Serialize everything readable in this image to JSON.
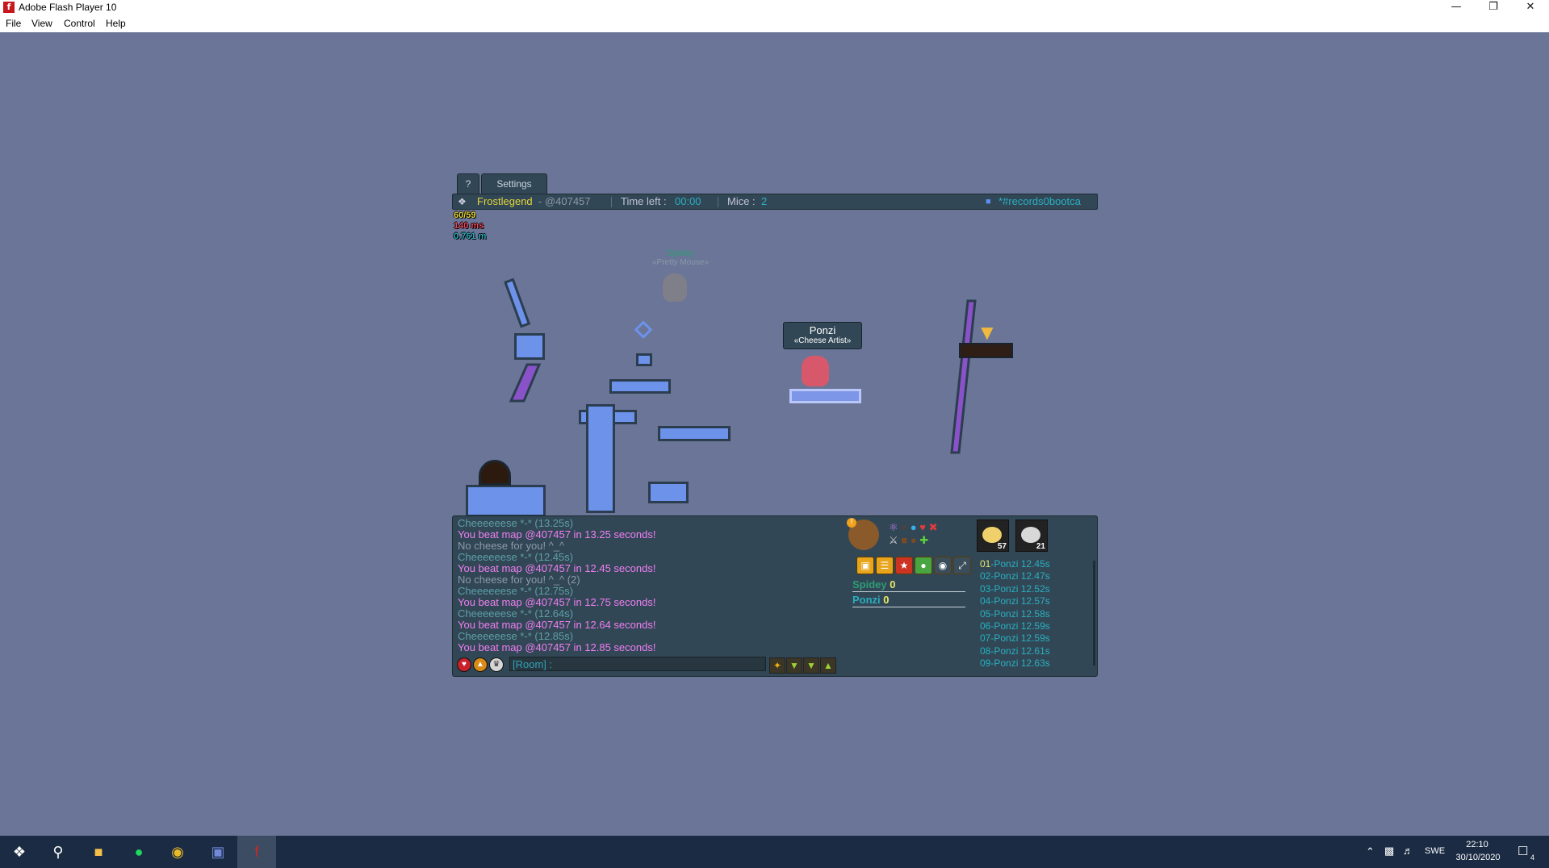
{
  "window": {
    "title": "Adobe Flash Player 10",
    "icon": "flash-icon",
    "controls": [
      "minimize",
      "restore",
      "close"
    ]
  },
  "menu": {
    "items": [
      "File",
      "View",
      "Control",
      "Help"
    ]
  },
  "game": {
    "tabs": {
      "help": "?",
      "settings": "Settings"
    },
    "infobar": {
      "author": "Frostlegend",
      "map_code": " - @407457",
      "time_label": "Time left :",
      "time_value": "00:00",
      "mice_label": "Mice :",
      "mice_value": "2",
      "room": "*#records0bootca"
    },
    "hud": {
      "fps": "60/59",
      "ping": "140 ms",
      "distance": "0.761 m"
    },
    "players": {
      "spidey_name": "Spidey",
      "spidey_title": "«Pretty Mouse»",
      "ponzi_name": "Ponzi",
      "ponzi_title": "«Cheese Artist»"
    },
    "chat": [
      {
        "text": "Cheeeeeese *-* ",
        "extra": "(13.25s)",
        "kind": "green"
      },
      {
        "text": "You beat map @407457 in 13.25 seconds!",
        "kind": "pink"
      },
      {
        "text": "No cheese for you! ^_^",
        "kind": "grey"
      },
      {
        "text": "Cheeeeeese *-* ",
        "extra": "(12.45s)",
        "kind": "green"
      },
      {
        "text": "You beat map @407457 in 12.45 seconds!",
        "kind": "pink"
      },
      {
        "text": "No cheese for you! ^_^ (2)",
        "kind": "grey"
      },
      {
        "text": "Cheeeeeese *-* ",
        "extra": "(12.75s)",
        "kind": "green"
      },
      {
        "text": "You beat map @407457 in 12.75 seconds!",
        "kind": "pink"
      },
      {
        "text": "Cheeeeeese *-* ",
        "extra": "(12.64s)",
        "kind": "green"
      },
      {
        "text": "You beat map @407457 in 12.64 seconds!",
        "kind": "pink"
      },
      {
        "text": "Cheeeeeese *-* ",
        "extra": "(12.85s)",
        "kind": "green"
      },
      {
        "text": "You beat map @407457 in 12.85 seconds!",
        "kind": "pink"
      }
    ],
    "chat_input_prefix": "[Room] :",
    "scores": [
      {
        "name": "Spidey",
        "score": "0"
      },
      {
        "name": "Ponzi",
        "score": "0"
      }
    ],
    "avatars": [
      {
        "count": "57"
      },
      {
        "count": "21"
      }
    ],
    "leaderboard": [
      {
        "rank": "01",
        "name": "-Ponzi ",
        "time": "12.45s"
      },
      {
        "rank": "02",
        "name": "-Ponzi ",
        "time": "12.47s"
      },
      {
        "rank": "03",
        "name": "-Ponzi ",
        "time": "12.52s"
      },
      {
        "rank": "04",
        "name": "-Ponzi ",
        "time": "12.57s"
      },
      {
        "rank": "05",
        "name": "-Ponzi ",
        "time": "12.58s"
      },
      {
        "rank": "06",
        "name": "-Ponzi ",
        "time": "12.59s"
      },
      {
        "rank": "07",
        "name": "-Ponzi ",
        "time": "12.59s"
      },
      {
        "rank": "08",
        "name": "-Ponzi ",
        "time": "12.61s"
      },
      {
        "rank": "09",
        "name": "-Ponzi ",
        "time": "12.63s"
      }
    ]
  },
  "taskbar": {
    "language": "SWE",
    "time": "22:10",
    "date": "30/10/2020",
    "notifications": "4"
  },
  "colors": {
    "background": "#6a7597",
    "panel": "#324756",
    "platform": "#6c92ea",
    "accent_pink": "#f07ef2",
    "accent_teal": "#2aafbf"
  }
}
